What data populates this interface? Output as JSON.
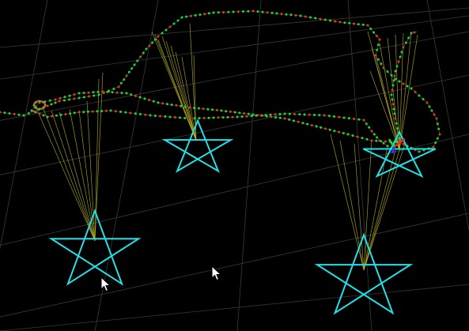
{
  "viewer": {
    "background": "#000000",
    "grid_color": "#3a3a3a",
    "marker_color": "#22e0e8",
    "ray_color": "#b8b020",
    "trajectory_colors": [
      "#2ecc40",
      "#e8342a"
    ],
    "axis_colors": [
      "#ff2020",
      "#20dd20",
      "#2040ff"
    ],
    "markers": [
      {
        "name": "marker-star-1"
      },
      {
        "name": "marker-star-2"
      },
      {
        "name": "marker-star-3"
      },
      {
        "name": "marker-star-4"
      }
    ],
    "cursor_icons": [
      "mouse-pointer-icon",
      "mouse-pointer-icon"
    ]
  }
}
